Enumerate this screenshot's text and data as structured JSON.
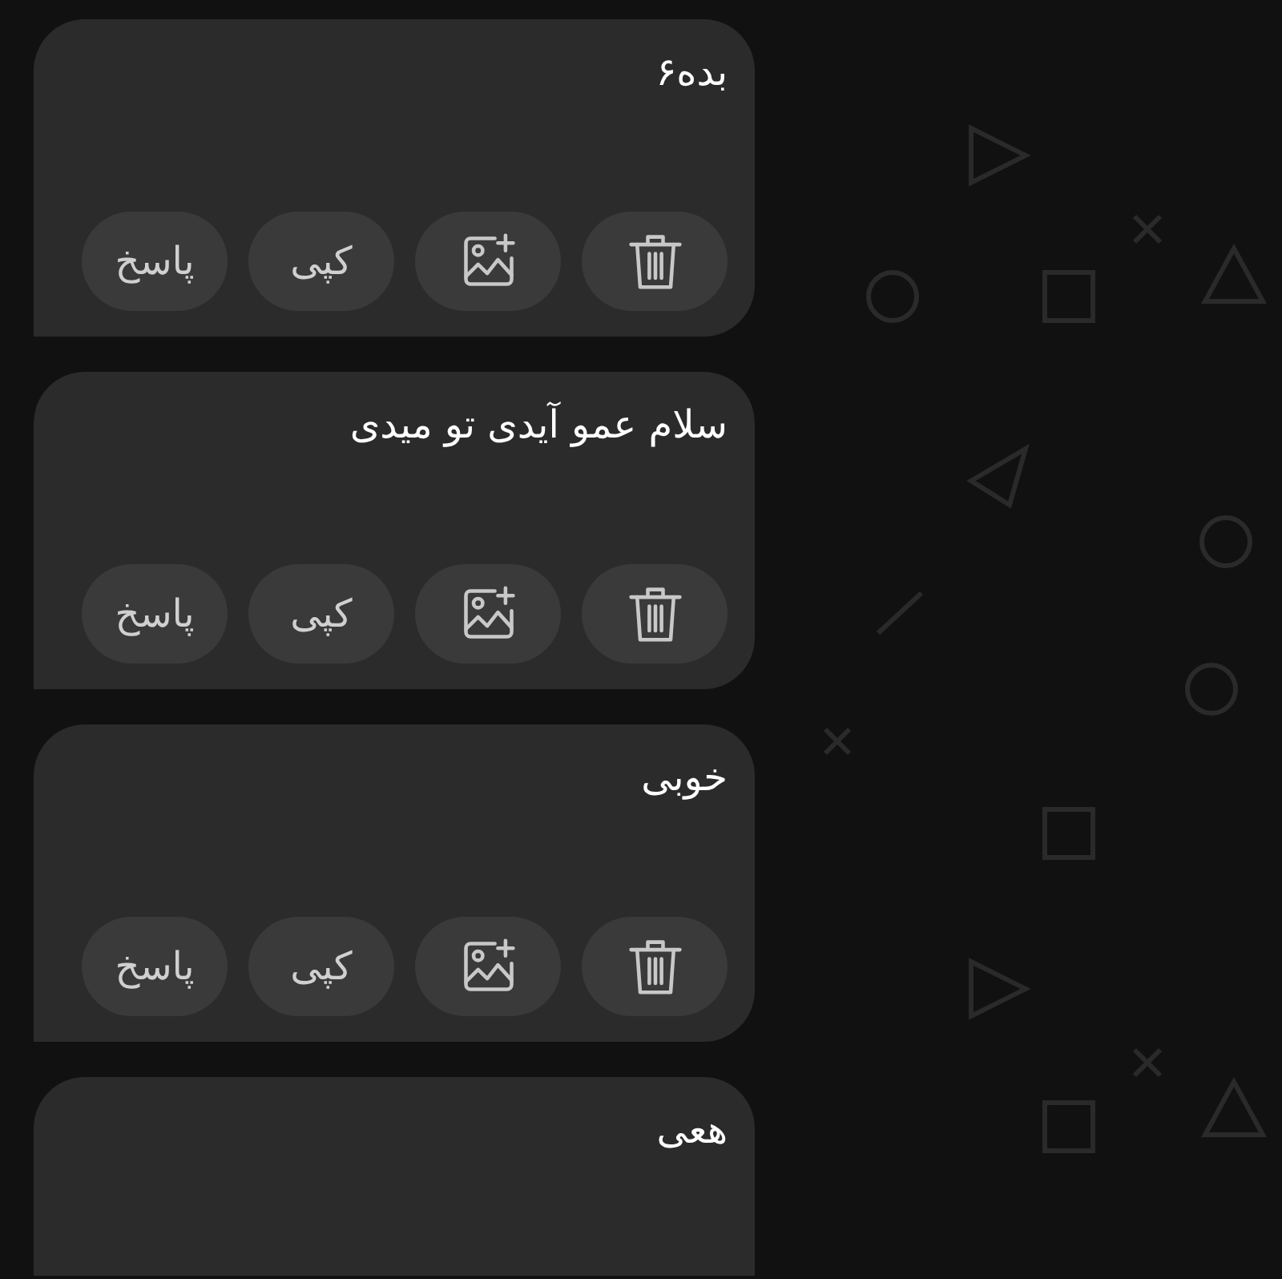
{
  "messages": [
    {
      "text": "بده۶",
      "actions": [
        {
          "kind": "delete"
        },
        {
          "kind": "add-image"
        },
        {
          "kind": "text",
          "label": "کپی"
        },
        {
          "kind": "text",
          "label": "پاسخ"
        }
      ]
    },
    {
      "text": "سلام عمو آیدی تو میدی",
      "actions": [
        {
          "kind": "delete"
        },
        {
          "kind": "add-image"
        },
        {
          "kind": "text",
          "label": "کپی"
        },
        {
          "kind": "text",
          "label": "پاسخ"
        }
      ]
    },
    {
      "text": "خوبی",
      "actions": [
        {
          "kind": "delete"
        },
        {
          "kind": "add-image"
        },
        {
          "kind": "text",
          "label": "کپی"
        },
        {
          "kind": "text",
          "label": "پاسخ"
        }
      ]
    },
    {
      "text": "هعی"
    }
  ]
}
